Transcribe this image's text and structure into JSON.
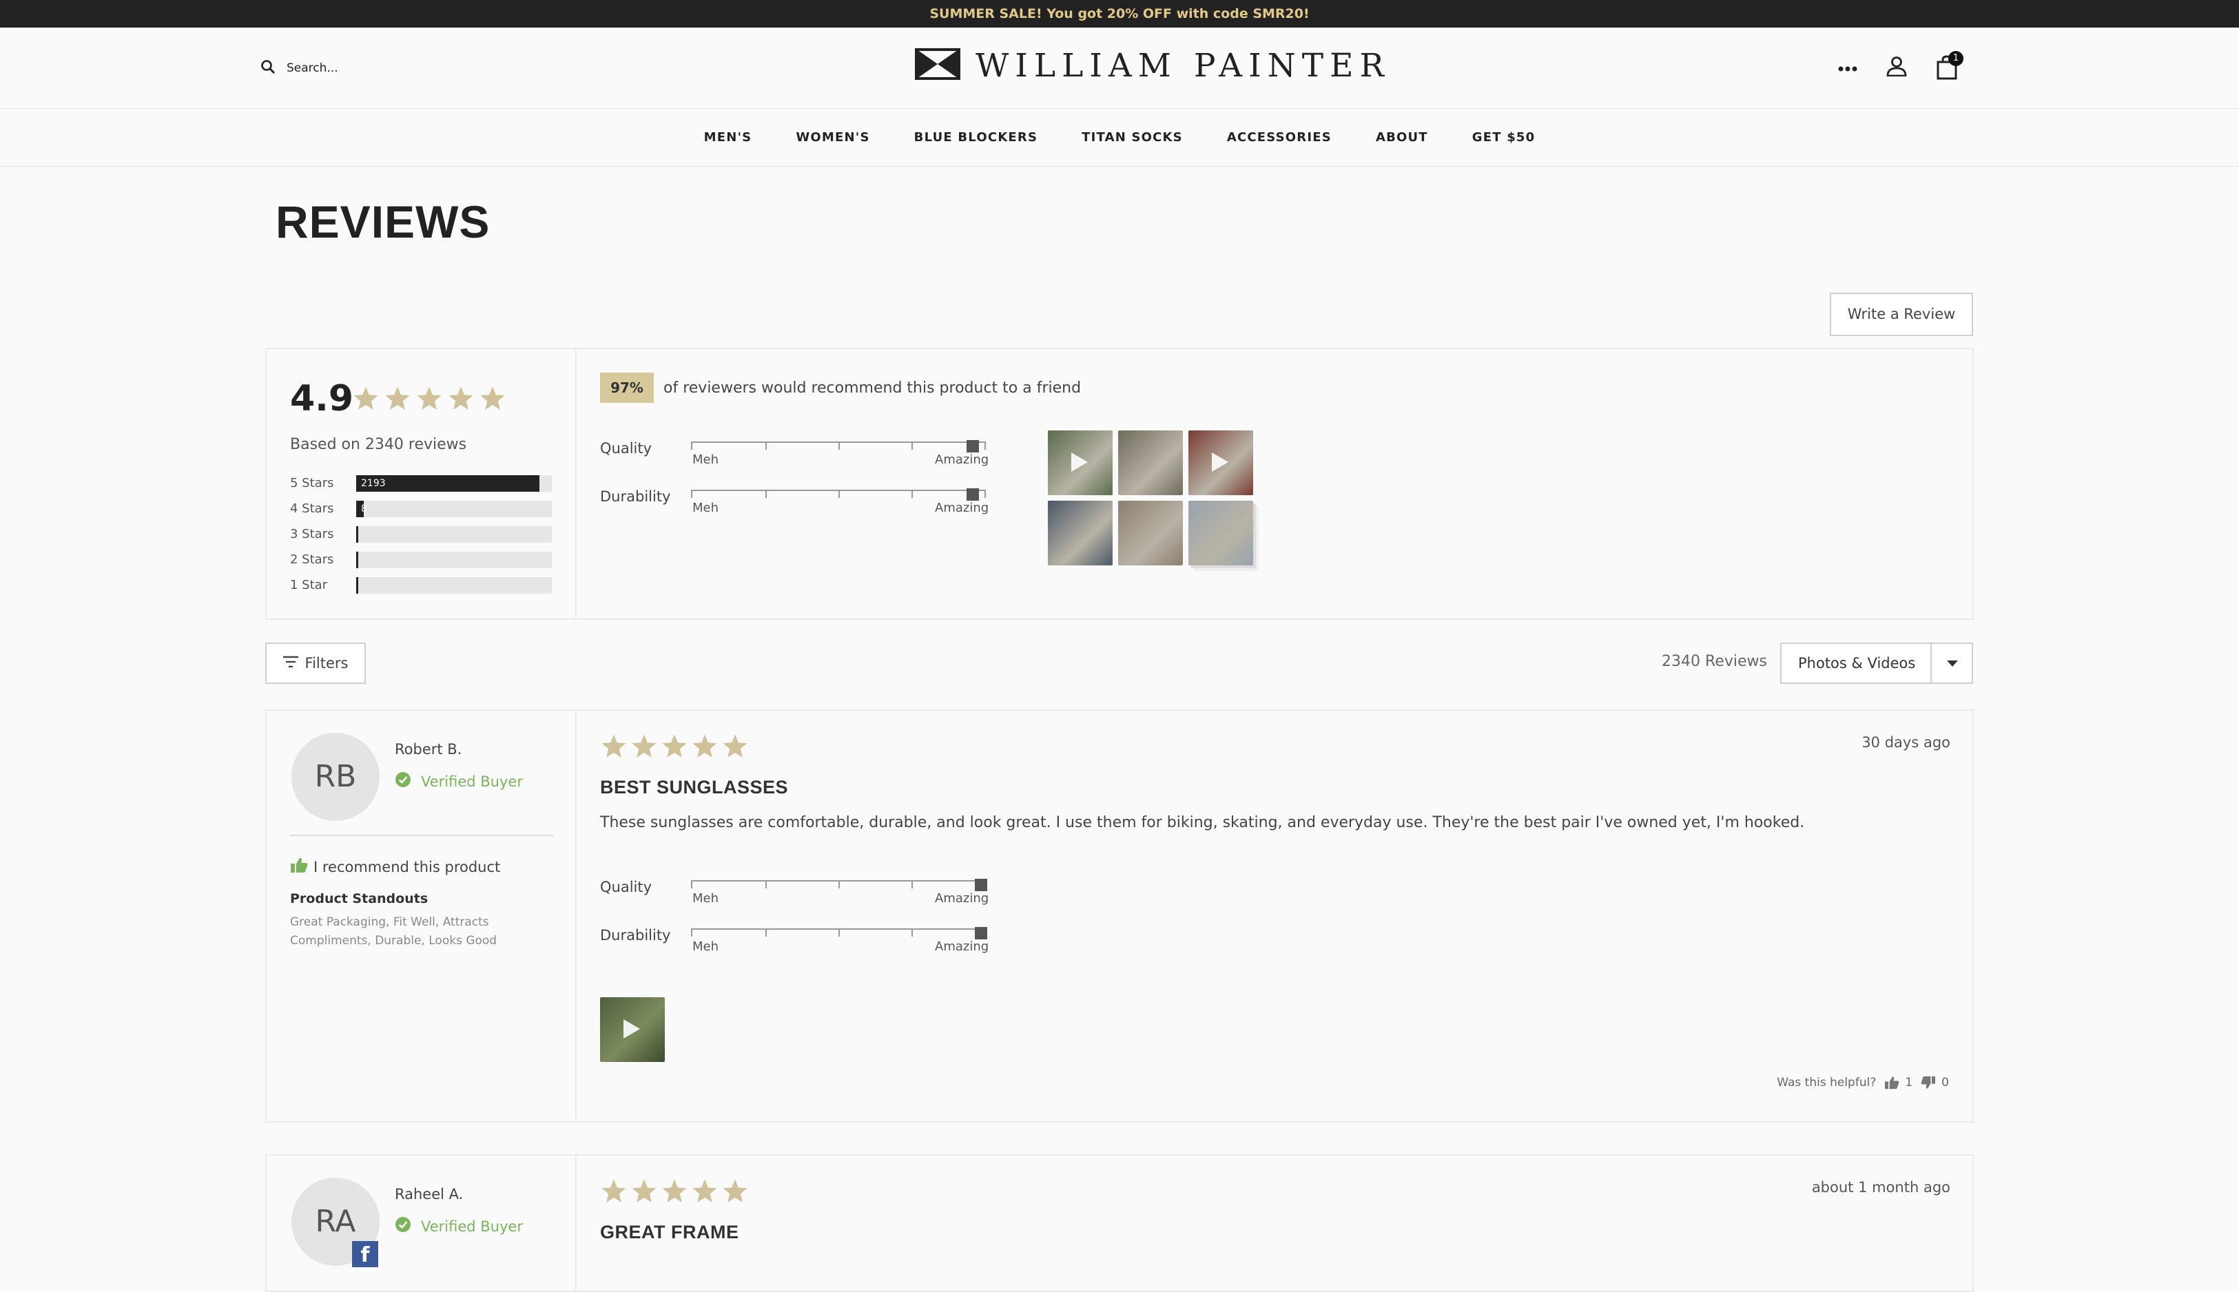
{
  "announcement": "SUMMER SALE! You got 20% OFF with code SMR20!",
  "header": {
    "search_placeholder": "Search...",
    "brand": "WILLIAM PAINTER",
    "cart_count": "1"
  },
  "nav": [
    "MEN'S",
    "WOMEN'S",
    "BLUE BLOCKERS",
    "TITAN SOCKS",
    "ACCESSORIES",
    "ABOUT",
    "GET $50"
  ],
  "page_title": "REVIEWS",
  "write_review_label": "Write a Review",
  "summary": {
    "average": "4.9",
    "average_stars": 5,
    "based_on": "Based on 2340 reviews",
    "distribution": [
      {
        "label": "5 Stars",
        "count": "2193",
        "fraction": 0.937
      },
      {
        "label": "4 Stars",
        "count": "8",
        "fraction": 0.03
      },
      {
        "label": "3 Stars",
        "count": "",
        "fraction": 0.0
      },
      {
        "label": "2 Stars",
        "count": "",
        "fraction": 0.0
      },
      {
        "label": "1 Star",
        "count": "",
        "fraction": 0.0
      }
    ],
    "recommend_pct": "97%",
    "recommend_text": "of reviewers would recommend this product to a friend",
    "sliders": [
      {
        "label": "Quality",
        "low": "Meh",
        "high": "Amazing",
        "value": 0.97
      },
      {
        "label": "Durability",
        "low": "Meh",
        "high": "Amazing",
        "value": 0.97
      }
    ],
    "media_thumbs": [
      {
        "type": "video",
        "color": "#5a6b4a"
      },
      {
        "type": "photo",
        "color": "#6e6a5c"
      },
      {
        "type": "video",
        "color": "#7a3a32"
      },
      {
        "type": "photo",
        "color": "#4a5766"
      },
      {
        "type": "photo",
        "color": "#8c7e6e"
      },
      {
        "type": "photo",
        "color": "#9aa4ad"
      }
    ]
  },
  "toolbar": {
    "filters_label": "Filters",
    "count_text": "2340 Reviews",
    "sort_label": "Photos & Videos"
  },
  "reviews": [
    {
      "initials": "RB",
      "name": "Robert B.",
      "verified": "Verified Buyer",
      "recommend": "I recommend this product",
      "standouts_title": "Product Standouts",
      "standouts": "Great Packaging, Fit Well, Attracts Compliments, Durable, Looks Good",
      "stars": 5,
      "date": "30 days ago",
      "title": "BEST SUNGLASSES",
      "body": "These sunglasses are comfortable, durable, and look great. I use them for biking, skating, and everyday use. They're the best pair I've owned yet, I'm hooked.",
      "sliders": [
        {
          "label": "Quality",
          "low": "Meh",
          "high": "Amazing",
          "value": 1.0
        },
        {
          "label": "Durability",
          "low": "Meh",
          "high": "Amazing",
          "value": 1.0
        }
      ],
      "helpful_label": "Was this helpful?",
      "helpful_yes": "1",
      "helpful_no": "0"
    },
    {
      "initials": "RA",
      "name": "Raheel A.",
      "verified": "Verified Buyer",
      "stars": 5,
      "date": "about 1 month ago",
      "title": "GREAT FRAME"
    }
  ],
  "colors": {
    "star": "#cfc199",
    "verified": "#7ab55c",
    "badge_bg": "#d8c99c",
    "announce_text": "#e2c98a"
  }
}
